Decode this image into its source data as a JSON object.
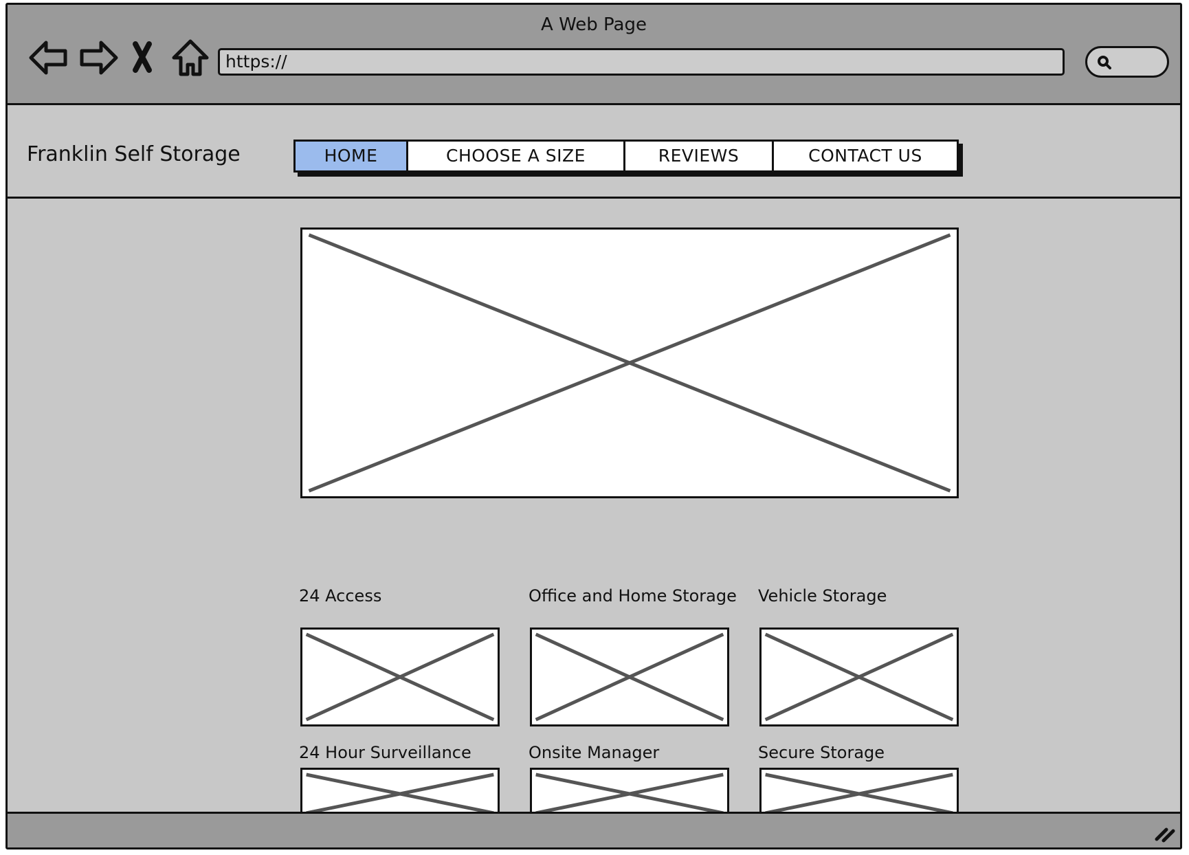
{
  "browser": {
    "window_title": "A Web Page",
    "address_value": "https://",
    "icons": [
      "back-icon",
      "forward-icon",
      "stop-icon",
      "home-icon",
      "search-icon",
      "resize-grip-icon"
    ]
  },
  "site": {
    "title": "Franklin Self Storage",
    "nav": [
      {
        "label": "HOME",
        "active": true
      },
      {
        "label": "CHOOSE A SIZE",
        "active": false
      },
      {
        "label": "REVIEWS",
        "active": false
      },
      {
        "label": "CONTACT US",
        "active": false
      }
    ]
  },
  "features": [
    {
      "label": "24 Access"
    },
    {
      "label": "Office and Home Storage"
    },
    {
      "label": "Vehicle Storage"
    },
    {
      "label": "24 Hour Surveillance"
    },
    {
      "label": "Onsite Manager"
    },
    {
      "label": "Secure Storage"
    }
  ],
  "colors": {
    "chrome": "#9a9a9a",
    "canvas": "#c8c8c8",
    "active_tab": "#9bbbed"
  }
}
